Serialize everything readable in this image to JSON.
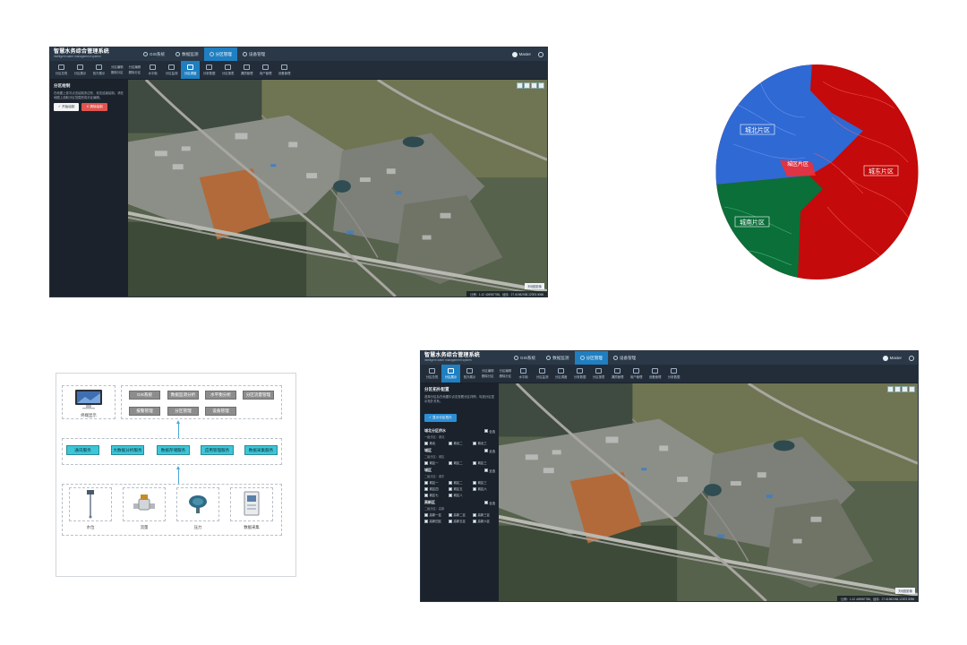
{
  "app": {
    "title": "智慧水务综合管理系统",
    "subtitle": "intelligent water management system",
    "user": "Master"
  },
  "nav": [
    {
      "label": "GIS系统"
    },
    {
      "label": "数据监测"
    },
    {
      "label": "分区管理"
    },
    {
      "label": "设备管理"
    }
  ],
  "toolbar": {
    "tools_left": [
      "分区总揽",
      "分区展示",
      "拓扑展示"
    ],
    "pair_a": [
      "分区编辑",
      "删除分区"
    ],
    "pair_b": [
      "分区编辑",
      "删除分区"
    ],
    "tools_right": [
      "水平衡",
      "分区监测",
      "分区调度",
      "分析数据",
      "分区报表",
      "漏损管理",
      "用户管理",
      "设备管理",
      "分析数据"
    ]
  },
  "window1": {
    "panel_title": "分区绘制",
    "panel_desc": "在地图上依次点击绘制多边形，双击结束绘制。请在地图上选取分区范围完成分区编辑。",
    "btn_start": "✓ 开始绘制",
    "btn_clear": "✕ 清除绘制",
    "status": "比例：1:12 426987788，经纬：27.61982058,12003.4058",
    "map_badge": "天地图影像"
  },
  "window2": {
    "panel_title": "分区拓扑配置",
    "panel_desc": "选择分区后在地图中点击查看分区详情，勾选分区显示拓扑关系。",
    "btn_show": "✓ 显示分区拓扑",
    "groups": [
      {
        "name": "城北分区供水",
        "sub": "一级分区：城北",
        "all": "全选",
        "items": [
          "城北",
          "城北二",
          "城北三"
        ]
      },
      {
        "name": "城区",
        "sub": "二级分区：城区",
        "all": "全选",
        "items": [
          "城区一",
          "城区二",
          "城区三"
        ]
      },
      {
        "name": "城区",
        "sub": "二级分区：城东",
        "all": "全选",
        "items": [
          "城区一",
          "城区二",
          "城区三",
          "城区四",
          "城区五",
          "城区六",
          "城区七",
          "城区八"
        ]
      },
      {
        "name": "高新区",
        "sub": "二级分区：高新",
        "all": "全选",
        "items": [
          "高新一区",
          "高新二区",
          "高新三区",
          "高新四区",
          "高新五区",
          "高新六区"
        ]
      }
    ],
    "status": "比例：1:12 426987788，经纬：27.61982058,12003.4058",
    "map_badge": "天地图影像"
  },
  "zone_map": {
    "north": "城北片区",
    "east": "城东片区",
    "south": "城南片区",
    "center": "城区片区",
    "colors": {
      "north": "#2f69d3",
      "east": "#c40a0a",
      "south": "#0b6f3a"
    }
  },
  "architecture": {
    "terminal_label": "终端显示",
    "apps_row1": [
      "GIS系统",
      "数据监测分析",
      "水平衡分析",
      "分区流量管理"
    ],
    "apps_row2": [
      "报警管理",
      "分区管理",
      "设备管理"
    ],
    "services": [
      "通讯服务",
      "大数据分析服务",
      "数据存储服务",
      "应用管理服务",
      "数据采集服务"
    ],
    "devices": [
      "水位",
      "流量",
      "压力",
      "数据采集"
    ],
    "colors": {
      "app": "#8d8d8d",
      "service": "#3cc6d8",
      "arrow": "#4aa8d8"
    }
  }
}
